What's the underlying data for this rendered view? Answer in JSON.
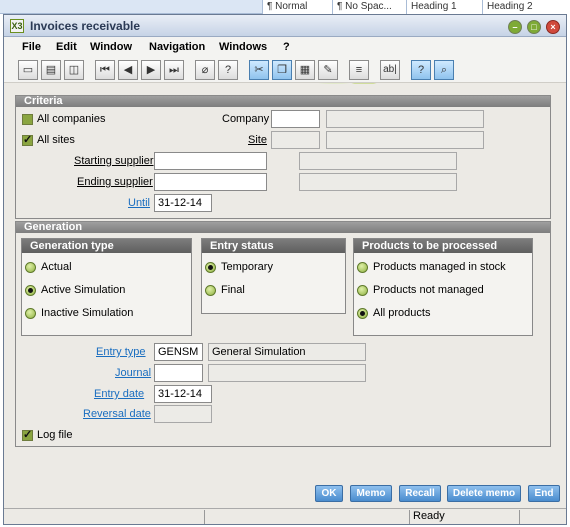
{
  "background_ribbon": {
    "styles": [
      "¶ Normal",
      "¶ No Spac...",
      "Heading 1",
      "Heading 2"
    ]
  },
  "window": {
    "app_icon": "X3",
    "title": "Invoices receivable"
  },
  "menu": [
    "File",
    "Edit",
    "Window",
    "Navigation",
    "Windows",
    "?"
  ],
  "toolbar": {
    "icons": [
      "new-icon",
      "print-icon",
      "print-preview-icon",
      "first-record-icon",
      "previous-record-icon",
      "next-record-icon",
      "last-record-icon",
      "attach-icon",
      "help-icon",
      "cut-icon",
      "copy-icon",
      "paste-icon",
      "edit-icon",
      "list-icon",
      "text-field-icon",
      "question-icon",
      "search-icon"
    ],
    "text_field_glyph": "ab|"
  },
  "criteria": {
    "title": "Criteria",
    "all_companies_label": "All companies",
    "all_companies_checked": false,
    "all_sites_label": "All sites",
    "all_sites_checked": true,
    "company_label": "Company",
    "site_label": "Site",
    "starting_supplier_label": "Starting supplier",
    "ending_supplier_label": "Ending supplier",
    "until_label": "Until",
    "until_value": "31-12-14"
  },
  "generation": {
    "title": "Generation",
    "generation_type": {
      "title": "Generation type",
      "options": [
        "Actual",
        "Active Simulation",
        "Inactive Simulation"
      ],
      "selected": "Active Simulation"
    },
    "entry_status": {
      "title": "Entry status",
      "options": [
        "Temporary",
        "Final"
      ],
      "selected": "Temporary"
    },
    "products": {
      "title": "Products to be processed",
      "options": [
        "Products managed in stock",
        "Products not managed",
        "All products"
      ],
      "selected": "All products"
    },
    "entry_type_label": "Entry type",
    "entry_type_code": "GENSM",
    "entry_type_desc": "General Simulation",
    "journal_label": "Journal",
    "entry_date_label": "Entry date",
    "entry_date_value": "31-12-14",
    "reversal_date_label": "Reversal date",
    "log_file_label": "Log file",
    "log_file_checked": true
  },
  "buttons": {
    "ok": "OK",
    "memo": "Memo",
    "recall": "Recall",
    "delete_memo": "Delete memo",
    "end": "End"
  },
  "status": {
    "text": "Ready"
  },
  "colors": {
    "accent_blue": "#4a8cce",
    "checkbox_green": "#8aa540",
    "section_header": "#7d7d7d"
  }
}
